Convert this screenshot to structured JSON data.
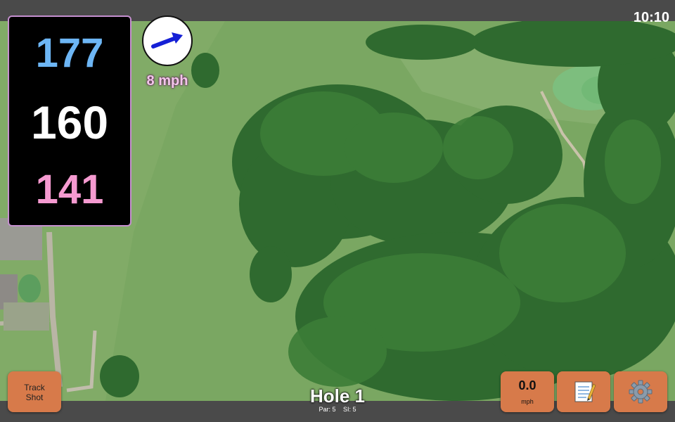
{
  "status_bar": {
    "time": "10:10"
  },
  "distances": {
    "back": "177",
    "center": "160",
    "front": "141"
  },
  "wind": {
    "speed_label": "8 mph",
    "arrow_icon": "wind-direction-arrow-icon"
  },
  "buttons": {
    "track_shot_line1": "Track",
    "track_shot_line2": "Shot",
    "wind_value": "0.0",
    "wind_unit": "mph",
    "notes_icon": "notepad-icon",
    "settings_icon": "gear-icon"
  },
  "hole": {
    "title": "Hole 1",
    "par": "Par: 5",
    "si": "SI: 5"
  },
  "colors": {
    "back": "#6db6f5",
    "center": "#ffffff",
    "front": "#f59ad0",
    "button": "#d77a4a"
  }
}
